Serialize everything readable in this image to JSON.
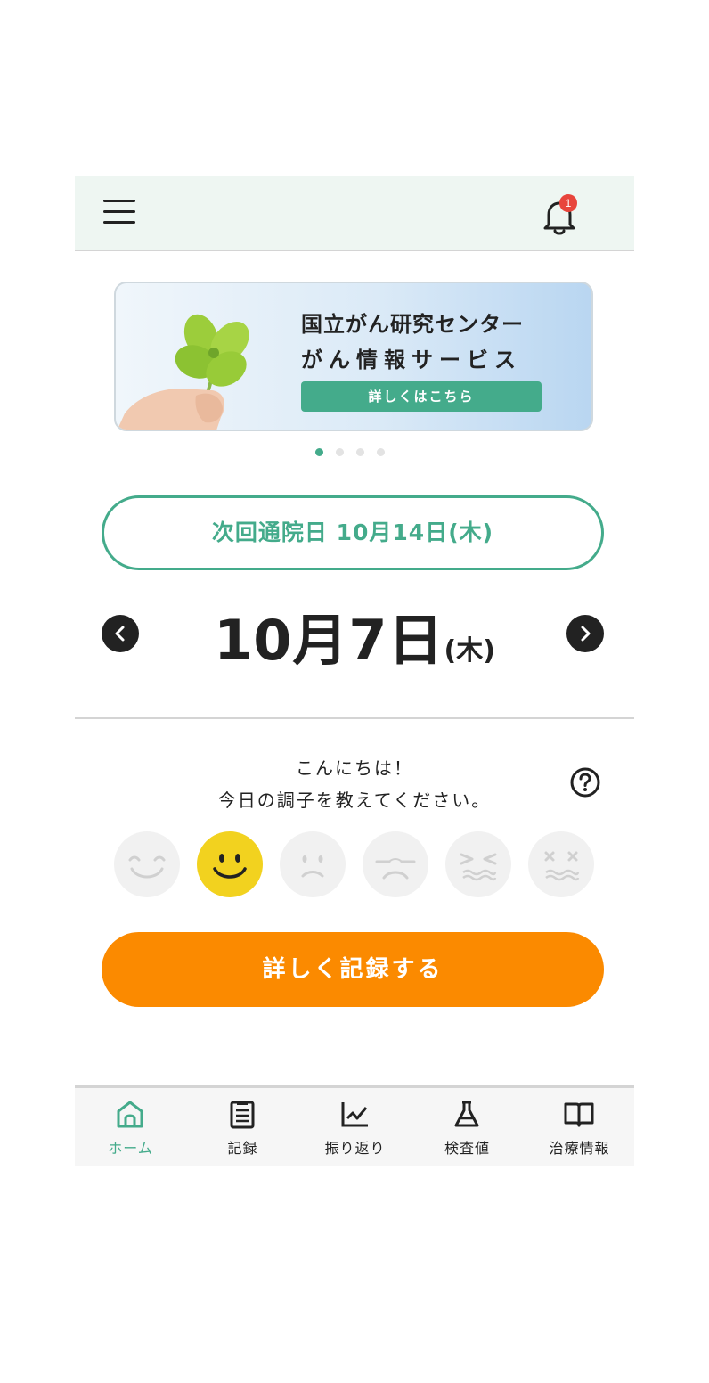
{
  "header": {
    "menu_icon": "hamburger-menu-icon",
    "bell_icon": "bell-icon",
    "notification_count": "1"
  },
  "banner": {
    "title_line1": "国立がん研究センター",
    "title_line2": "がん情報サービス",
    "button_label": "詳しくはこちら",
    "image": "four-leaf-clover-photo",
    "slide_count": 4,
    "active_slide": 1
  },
  "next_visit": {
    "label": "次回通院日 10月14日(木)"
  },
  "date": {
    "main": "10月7日",
    "day_of_week": "(木)",
    "prev_icon": "chevron-left-icon",
    "next_icon": "chevron-right-icon"
  },
  "greeting": {
    "line1": "こんにちは！",
    "line2": "今日の調子を教えてください。",
    "help_icon": "question-circle-icon"
  },
  "moods": {
    "options": [
      "very-happy-face-icon",
      "happy-face-icon",
      "neutral-face-icon",
      "sad-face-icon",
      "painful-face-icon",
      "very-painful-face-icon"
    ],
    "selected_index": 1
  },
  "record_button": {
    "label": "詳しく記録する"
  },
  "bottom_nav": {
    "items": [
      {
        "label": "ホーム",
        "icon": "home-icon",
        "active": true
      },
      {
        "label": "記録",
        "icon": "clipboard-icon",
        "active": false
      },
      {
        "label": "振り返り",
        "icon": "chart-icon",
        "active": false
      },
      {
        "label": "検査値",
        "icon": "flask-icon",
        "active": false
      },
      {
        "label": "治療情報",
        "icon": "book-icon",
        "active": false
      }
    ]
  },
  "colors": {
    "accent_green": "#44ab8b",
    "header_bg": "#eef6f2",
    "record_orange": "#fb8a00",
    "selected_mood_yellow": "#f2d21f",
    "badge_red": "#e8453c"
  }
}
